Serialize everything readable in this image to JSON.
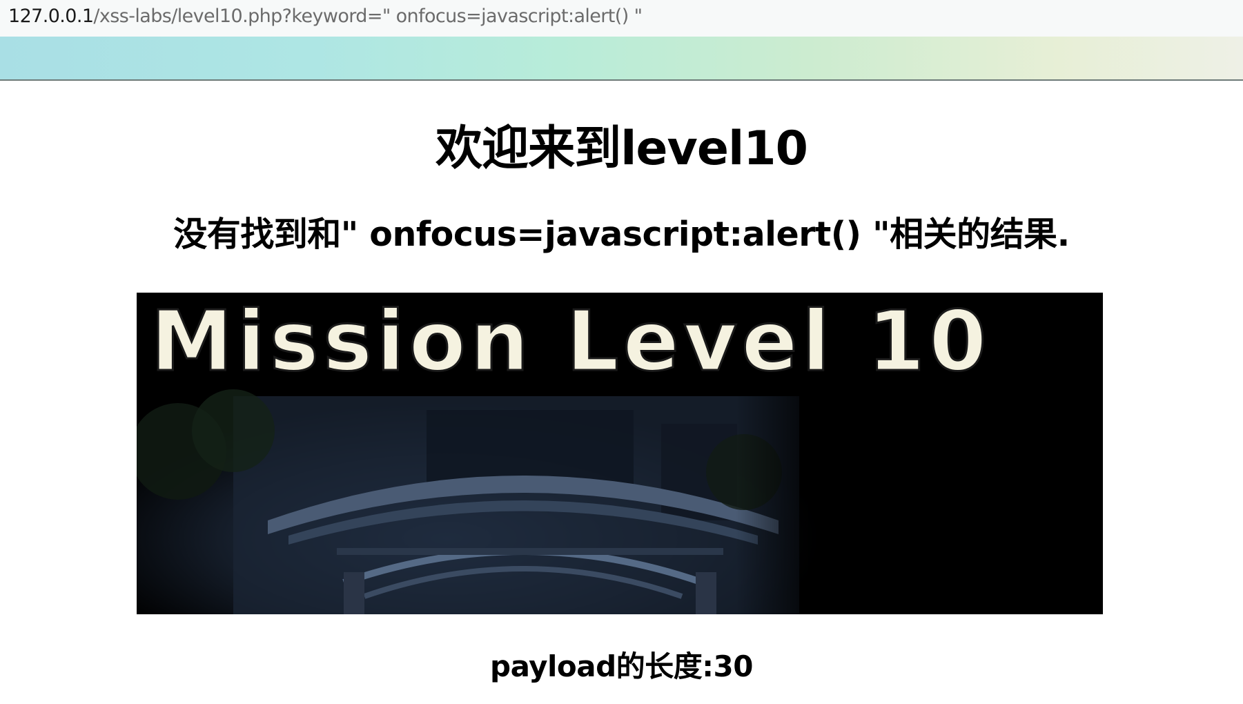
{
  "browser": {
    "url_host": "127.0.0.1",
    "url_path": "/xss-labs/level10.php?keyword=\" onfocus=javascript:alert() \""
  },
  "page": {
    "title": "欢迎来到level10",
    "result_text": "没有找到和\" onfocus=javascript:alert() \"相关的结果.",
    "image_caption": "Mission Level 10",
    "payload_length_text": "payload的长度:30"
  },
  "colors": {
    "banner_gradient": [
      "#a9dfe5",
      "#b8ecd9",
      "#e7efd6"
    ],
    "image_text": "#f5f2e0",
    "image_bg": "#000000"
  }
}
